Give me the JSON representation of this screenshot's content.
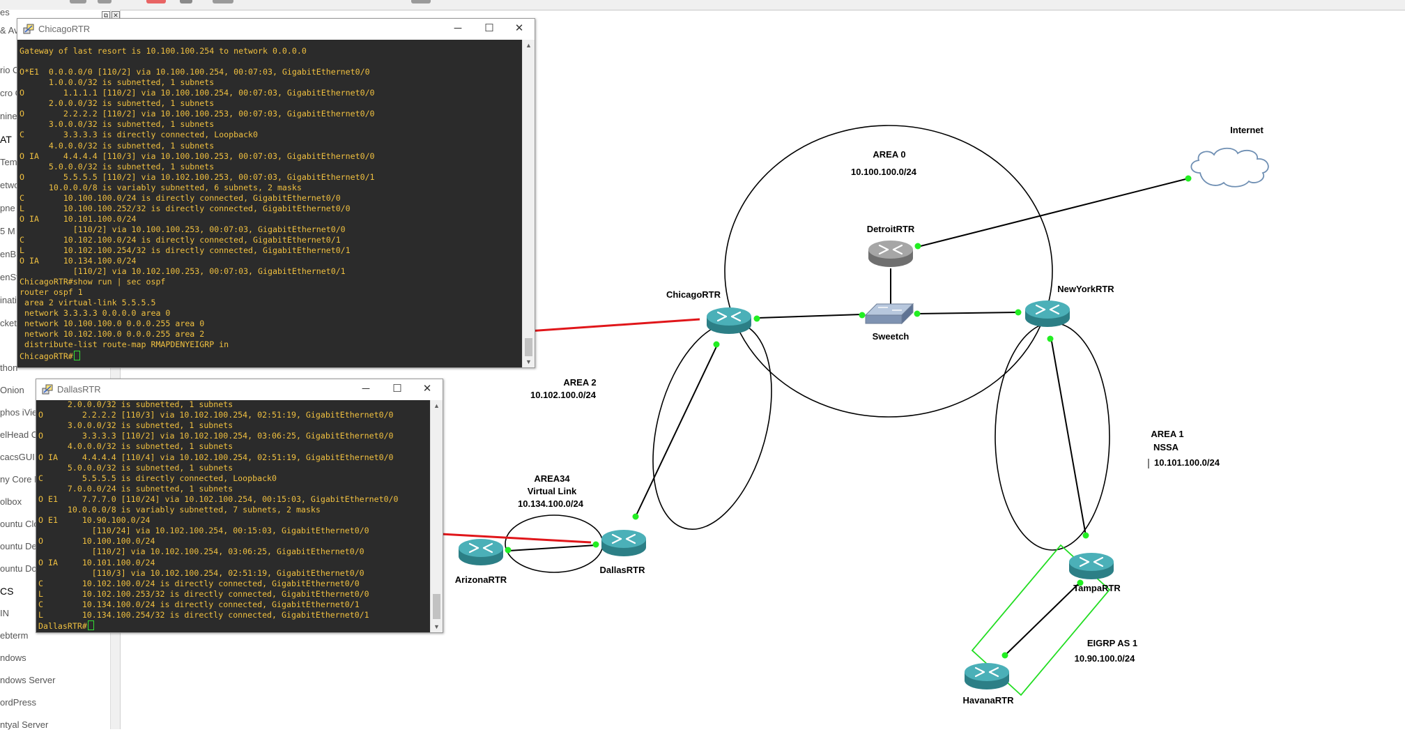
{
  "sidebar": {
    "items": [
      {
        "label": "es"
      },
      {
        "label": "& Ava"
      },
      {
        "label": "rio C"
      },
      {
        "label": "cro G"
      },
      {
        "label": "nine"
      },
      {
        "label": "AT"
      },
      {
        "label": "Tem"
      },
      {
        "label": "etwo"
      },
      {
        "label": "pne"
      },
      {
        "label": "5 M"
      },
      {
        "label": "enB"
      },
      {
        "label": "enSt"
      },
      {
        "label": "inati"
      },
      {
        "label": "cket"
      },
      {
        "label": "thon"
      },
      {
        "label": "Onion"
      },
      {
        "label": "phos iView"
      },
      {
        "label": "elHead C"
      },
      {
        "label": "cacsGUI"
      },
      {
        "label": "ny Core Li"
      },
      {
        "label": "olbox"
      },
      {
        "label": "ountu Clou"
      },
      {
        "label": "ountu Desk"
      },
      {
        "label": "ountu Doc"
      },
      {
        "label": "CS"
      },
      {
        "label": "IN"
      },
      {
        "label": "ebterm"
      },
      {
        "label": "ndows"
      },
      {
        "label": "ndows Server"
      },
      {
        "label": "ordPress"
      },
      {
        "label": "ntyal Server"
      }
    ]
  },
  "topology": {
    "areas": [
      {
        "name": "AREA 0",
        "subnet": "10.100.100.0/24"
      },
      {
        "name": "AREA 2",
        "subnet": "10.102.100.0/24"
      },
      {
        "name": "AREA34",
        "sub": "Virtual Link",
        "subnet": "10.134.100.0/24"
      },
      {
        "name": "AREA 1",
        "sub": "NSSA",
        "subnet": "10.101.100.0/24"
      },
      {
        "name": "EIGRP AS 1",
        "subnet": "10.90.100.0/24"
      }
    ],
    "nodes": {
      "internet": "Internet",
      "detroit": "DetroitRTR",
      "chicago": "ChicagoRTR",
      "newyork": "NewYorkRTR",
      "sweetch": "Sweetch",
      "dallas": "DallasRTR",
      "arizona": "ArizonaRTR",
      "tampa": "TampaRTR",
      "havana": "HavanaRTR"
    },
    "colors": {
      "router": "#3a9aa3",
      "link_dot": "#22ee22",
      "arrow": "#e0161a",
      "eigrp_box": "#22dd22"
    }
  },
  "consoles": {
    "chicago": {
      "title": "ChicagoRTR",
      "lines": [
        "",
        "Gateway of last resort is 10.100.100.254 to network 0.0.0.0",
        "",
        "O*E1  0.0.0.0/0 [110/2] via 10.100.100.254, 00:07:03, GigabitEthernet0/0",
        "      1.0.0.0/32 is subnetted, 1 subnets",
        "O        1.1.1.1 [110/2] via 10.100.100.254, 00:07:03, GigabitEthernet0/0",
        "      2.0.0.0/32 is subnetted, 1 subnets",
        "O        2.2.2.2 [110/2] via 10.100.100.253, 00:07:03, GigabitEthernet0/0",
        "      3.0.0.0/32 is subnetted, 1 subnets",
        "C        3.3.3.3 is directly connected, Loopback0",
        "      4.0.0.0/32 is subnetted, 1 subnets",
        "O IA     4.4.4.4 [110/3] via 10.100.100.253, 00:07:03, GigabitEthernet0/0",
        "      5.0.0.0/32 is subnetted, 1 subnets",
        "O        5.5.5.5 [110/2] via 10.102.100.253, 00:07:03, GigabitEthernet0/1",
        "      10.0.0.0/8 is variably subnetted, 6 subnets, 2 masks",
        "C        10.100.100.0/24 is directly connected, GigabitEthernet0/0",
        "L        10.100.100.252/32 is directly connected, GigabitEthernet0/0",
        "O IA     10.101.100.0/24",
        "           [110/2] via 10.100.100.253, 00:07:03, GigabitEthernet0/0",
        "C        10.102.100.0/24 is directly connected, GigabitEthernet0/1",
        "L        10.102.100.254/32 is directly connected, GigabitEthernet0/1",
        "O IA     10.134.100.0/24",
        "           [110/2] via 10.102.100.253, 00:07:03, GigabitEthernet0/1",
        "ChicagoRTR#show run | sec ospf",
        "router ospf 1",
        " area 2 virtual-link 5.5.5.5",
        " network 3.3.3.3 0.0.0.0 area 0",
        " network 10.100.100.0 0.0.0.255 area 0",
        " network 10.102.100.0 0.0.0.255 area 2",
        " distribute-list route-map RMAPDENYEIGRP in",
        "ChicagoRTR#"
      ]
    },
    "dallas": {
      "title": "DallasRTR",
      "lines": [
        "      2.0.0.0/32 is subnetted, 1 subnets",
        "O        2.2.2.2 [110/3] via 10.102.100.254, 02:51:19, GigabitEthernet0/0",
        "      3.0.0.0/32 is subnetted, 1 subnets",
        "O        3.3.3.3 [110/2] via 10.102.100.254, 03:06:25, GigabitEthernet0/0",
        "      4.0.0.0/32 is subnetted, 1 subnets",
        "O IA     4.4.4.4 [110/4] via 10.102.100.254, 02:51:19, GigabitEthernet0/0",
        "      5.0.0.0/32 is subnetted, 1 subnets",
        "C        5.5.5.5 is directly connected, Loopback0",
        "      7.0.0.0/24 is subnetted, 1 subnets",
        "O E1     7.7.7.0 [110/24] via 10.102.100.254, 00:15:03, GigabitEthernet0/0",
        "      10.0.0.0/8 is variably subnetted, 7 subnets, 2 masks",
        "O E1     10.90.100.0/24",
        "           [110/24] via 10.102.100.254, 00:15:03, GigabitEthernet0/0",
        "O        10.100.100.0/24",
        "           [110/2] via 10.102.100.254, 03:06:25, GigabitEthernet0/0",
        "O IA     10.101.100.0/24",
        "           [110/3] via 10.102.100.254, 02:51:19, GigabitEthernet0/0",
        "C        10.102.100.0/24 is directly connected, GigabitEthernet0/0",
        "L        10.102.100.253/32 is directly connected, GigabitEthernet0/0",
        "C        10.134.100.0/24 is directly connected, GigabitEthernet0/1",
        "L        10.134.100.254/32 is directly connected, GigabitEthernet0/1",
        "DallasRTR#"
      ]
    }
  }
}
